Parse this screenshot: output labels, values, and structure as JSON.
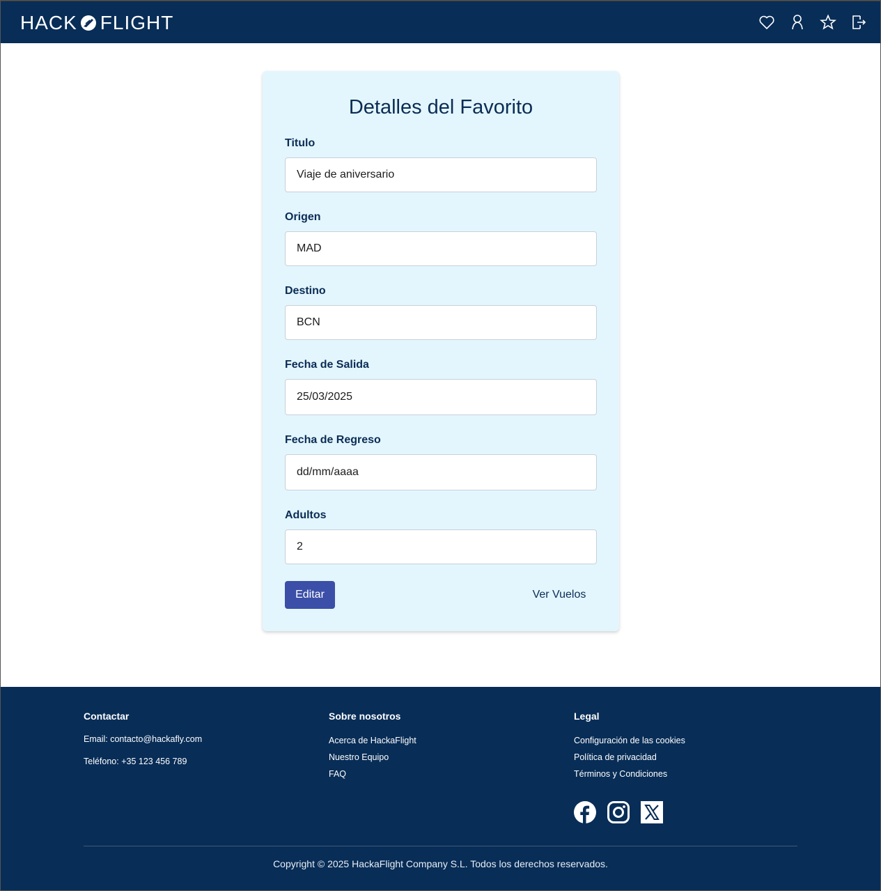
{
  "header": {
    "logo_left": "HACK",
    "logo_right": "FLIGHT",
    "icons": [
      "heart-icon",
      "user-icon",
      "star-icon",
      "logout-icon"
    ]
  },
  "card": {
    "title": "Detalles del Favorito",
    "fields": [
      {
        "label": "Titulo",
        "value": "Viaje de aniversario"
      },
      {
        "label": "Origen",
        "value": "MAD"
      },
      {
        "label": "Destino",
        "value": "BCN"
      },
      {
        "label": "Fecha de Salida",
        "value": "25/03/2025"
      },
      {
        "label": "Fecha de Regreso",
        "value": "dd/mm/aaaa"
      },
      {
        "label": "Adultos",
        "value": "2"
      }
    ],
    "edit_label": "Editar",
    "view_flights_label": "Ver Vuelos"
  },
  "footer": {
    "contact": {
      "heading": "Contactar",
      "email": "Email: contacto@hackafly.com",
      "phone": "Teléfono: +35 123 456 789"
    },
    "about": {
      "heading": "Sobre nosotros",
      "links": [
        "Acerca de HackaFlight",
        "Nuestro Equipo",
        "FAQ"
      ]
    },
    "legal": {
      "heading": "Legal",
      "links": [
        "Configuración de las cookies",
        "Política de privacidad",
        "Términos y Condiciones"
      ]
    },
    "social_icons": [
      "facebook-icon",
      "instagram-icon",
      "x-icon"
    ],
    "copyright": "Copyright © 2025 HackaFlight Company S.L. Todos los derechos reservados."
  },
  "colors": {
    "navy": "#082d57",
    "card_bg": "#e3f6fd",
    "button": "#3b4fa8"
  }
}
